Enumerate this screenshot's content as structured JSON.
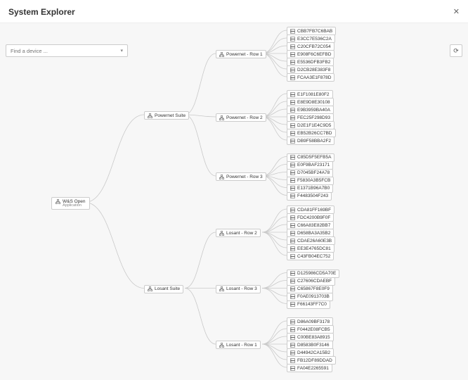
{
  "header": {
    "title": "System Explorer"
  },
  "search": {
    "placeholder": "Find a device ..."
  },
  "root": {
    "label": "W&S Open",
    "subtitle": "Application"
  },
  "suites": [
    {
      "label": "Powernet Suite"
    },
    {
      "label": "Losant Suite"
    }
  ],
  "rows": [
    {
      "label": "Powernet - Row 1"
    },
    {
      "label": "Powernet - Row 2"
    },
    {
      "label": "Powernet - Row 3"
    },
    {
      "label": "Losant - Row 2"
    },
    {
      "label": "Losant - Row 3"
    },
    {
      "label": "Losant - Row 1"
    }
  ],
  "leaves": [
    [
      "CBB7FB7C6BAB",
      "E3CC7E536C2A",
      "C20CFB72C054",
      "E908F6C6EFBD",
      "E5536DFB3FB2",
      "D2CB28E383F8",
      "FCAA3E1F878D"
    ],
    [
      "E1F1081E80F2",
      "E8E9D8E30108",
      "E9B3959BA40A",
      "FEC25F298D93",
      "D2E1F1E4C9D5",
      "EB52B26CC7BD",
      "DB9F58BBA2F2"
    ],
    [
      "C85D5F5EFB5A",
      "E0F9BAF23171",
      "D7045BF24A78",
      "F5830A3B5FCB",
      "E1371B96A7B0",
      "F4483504F243"
    ],
    [
      "CDA81FF169BF",
      "FDC4200B9F0F",
      "C66A83E82BB7",
      "D658BA3A35B2",
      "CDAE26A60E3B",
      "EE3E4765DC81",
      "C43FB04EC752"
    ],
    [
      "D125986CD5A70E",
      "C27606CDAEBF",
      "C65867F8E0F9",
      "F0AE0913703B",
      "F66143FF7C0"
    ],
    [
      "D86A09BF3178",
      "F0442E08FCB5",
      "C00BE83A8915",
      "D8583B0F3146",
      "D44942CA15B2",
      "FB12DF89DDAD",
      "FA04E2265591"
    ]
  ]
}
